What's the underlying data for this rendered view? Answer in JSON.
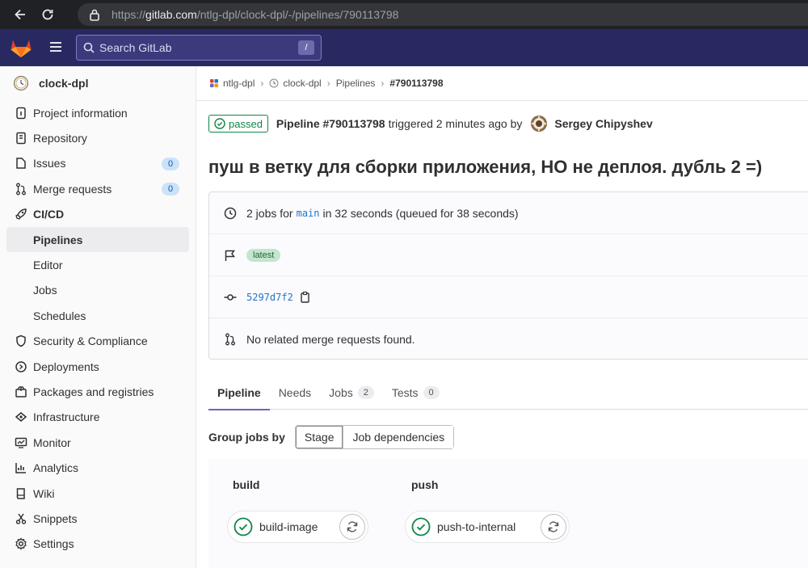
{
  "browser": {
    "url_prefix": "https://",
    "url_host": "gitlab.com",
    "url_path": "/ntlg-dpl/clock-dpl/-/pipelines/790113798"
  },
  "header": {
    "search_placeholder": "Search GitLab",
    "search_shortcut": "/",
    "brand_color": "#292961"
  },
  "sidebar": {
    "project_name": "clock-dpl",
    "items": [
      {
        "label": "Project information",
        "icon": "info-icon"
      },
      {
        "label": "Repository",
        "icon": "book-icon"
      },
      {
        "label": "Issues",
        "icon": "issues-icon",
        "count": "0"
      },
      {
        "label": "Merge requests",
        "icon": "merge-request-icon",
        "count": "0"
      },
      {
        "label": "CI/CD",
        "icon": "rocket-icon"
      },
      {
        "label": "Pipelines"
      },
      {
        "label": "Editor"
      },
      {
        "label": "Jobs"
      },
      {
        "label": "Schedules"
      },
      {
        "label": "Security & Compliance",
        "icon": "shield-icon"
      },
      {
        "label": "Deployments",
        "icon": "deployments-icon"
      },
      {
        "label": "Packages and registries",
        "icon": "package-icon"
      },
      {
        "label": "Infrastructure",
        "icon": "cloud-gear-icon"
      },
      {
        "label": "Monitor",
        "icon": "monitor-icon"
      },
      {
        "label": "Analytics",
        "icon": "chart-icon"
      },
      {
        "label": "Wiki",
        "icon": "wiki-book-icon"
      },
      {
        "label": "Snippets",
        "icon": "scissors-icon"
      },
      {
        "label": "Settings",
        "icon": "gear-icon"
      }
    ]
  },
  "breadcrumb": {
    "group": "ntlg-dpl",
    "project": "clock-dpl",
    "section": "Pipelines",
    "current": "#790113798"
  },
  "pipeline": {
    "status": "passed",
    "name": "Pipeline #790113798",
    "triggered_text": "triggered 2 minutes ago by",
    "user": "Sergey Chipyshev",
    "title": "пуш в ветку для сборки приложения, НО не деплоя. дубль 2 =)",
    "jobs_prefix": "2 jobs for",
    "branch": "main",
    "jobs_suffix": "in 32 seconds (queued for 38 seconds)",
    "tag": "latest",
    "sha": "5297d7f2",
    "mr_text": "No related merge requests found."
  },
  "tabs": [
    {
      "label": "Pipeline"
    },
    {
      "label": "Needs"
    },
    {
      "label": "Jobs",
      "count": "2"
    },
    {
      "label": "Tests",
      "count": "0"
    }
  ],
  "group_by": {
    "label": "Group jobs by",
    "options": [
      "Stage",
      "Job dependencies"
    ],
    "selected": "Stage"
  },
  "stages": [
    {
      "name": "build",
      "job": "build-image",
      "job_status": "success"
    },
    {
      "name": "push",
      "job": "push-to-internal",
      "job_status": "success"
    }
  ],
  "colors": {
    "success": "#108548",
    "link": "#1f75cb",
    "active_tab": "#6666c4"
  }
}
